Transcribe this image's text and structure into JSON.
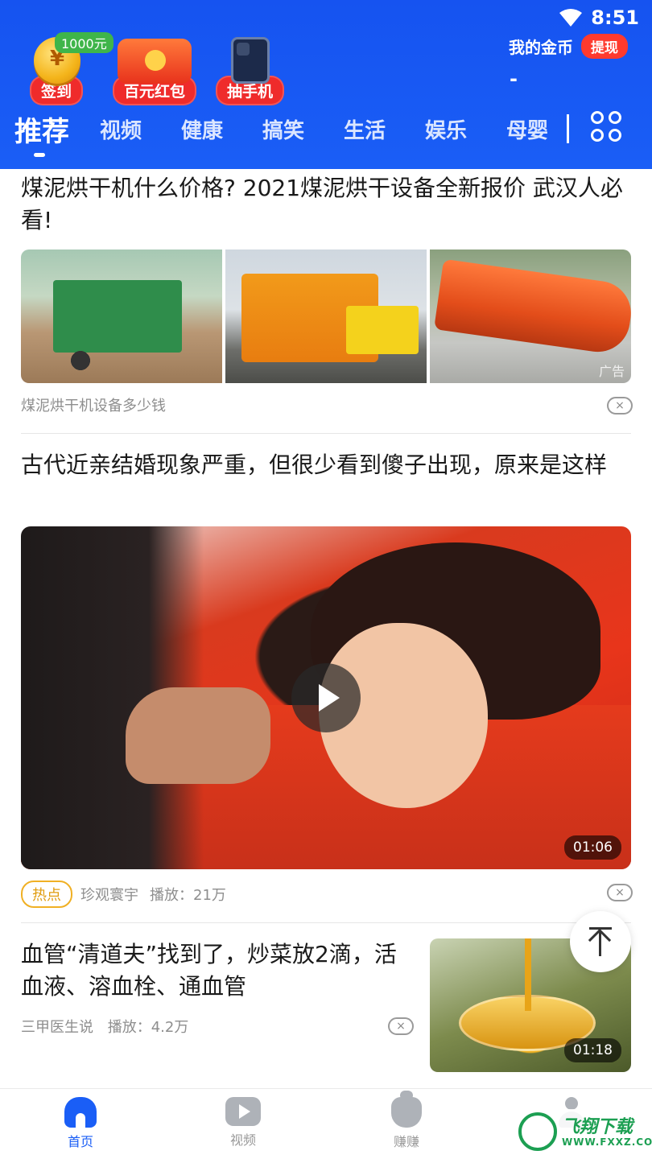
{
  "status_bar": {
    "time": "8:51",
    "wifi_icon": "wifi-icon"
  },
  "promos": [
    {
      "label": "签到",
      "badge": "1000元",
      "badge_symbol": "¥",
      "icon": "coin-icon"
    },
    {
      "label": "百元红包",
      "badge_symbol": "¥",
      "icon": "red-envelope-icon"
    },
    {
      "label": "抽手机",
      "icon": "phone-icon"
    }
  ],
  "gold": {
    "title": "我的金币",
    "withdraw_label": "提现",
    "value": "-"
  },
  "tabs": [
    {
      "label": "推荐",
      "active": true
    },
    {
      "label": "视频"
    },
    {
      "label": "健康"
    },
    {
      "label": "搞笑"
    },
    {
      "label": "生活"
    },
    {
      "label": "娱乐"
    },
    {
      "label": "母婴"
    }
  ],
  "feed": {
    "ad": {
      "title": "煤泥烘干机什么价格? 2021煤泥烘干设备全新报价 武汉人必看!",
      "source": "煤泥烘干机设备多少钱",
      "ad_mark": "广告",
      "close_label": "×"
    },
    "video_article": {
      "title": "古代近亲结婚现象严重，但很少看到傻子出现，原来是这样",
      "duration": "01:06",
      "tag": "热点",
      "source": "珍观寰宇",
      "plays": "播放：21万",
      "close_label": "×"
    },
    "side_article": {
      "title": "血管“清道夫”找到了，炒菜放2滴，活血液、溶血栓、通血管",
      "source": "三甲医生说",
      "plays": "播放：4.2万",
      "duration": "01:18",
      "close_label": "×"
    }
  },
  "bottom_nav": [
    {
      "label": "首页",
      "icon": "home-icon",
      "active": true
    },
    {
      "label": "视频",
      "icon": "video-icon"
    },
    {
      "label": "赚赚",
      "icon": "money-bag-icon"
    },
    {
      "label": "",
      "icon": "user-icon"
    }
  ],
  "watermark": {
    "name": "飞翔下载",
    "url": "WWW.FXXZ.COM"
  },
  "colors": {
    "header_blue": "#1a5ef6",
    "accent_red": "#ef2b2b",
    "hot_tag": "#f0b024"
  }
}
